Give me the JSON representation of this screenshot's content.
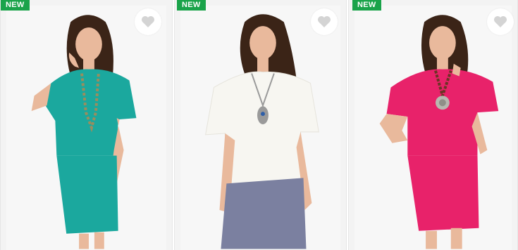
{
  "products": [
    {
      "badge": "NEW",
      "favorite_icon": "heart-icon",
      "outfit_color": "#1ba89e",
      "bottom_color": "#1ba89e",
      "necklace_color": "#9a8d5e",
      "pendant_shape": "beads"
    },
    {
      "badge": "NEW",
      "favorite_icon": "heart-icon",
      "outfit_color": "#f7f6f1",
      "bottom_color": "#7b80a0",
      "necklace_color": "#9a9a9a",
      "pendant_shape": "owl"
    },
    {
      "badge": "NEW",
      "favorite_icon": "heart-icon",
      "outfit_color": "#e8226a",
      "bottom_color": "#e8226a",
      "necklace_color": "#6b3424",
      "pendant_shape": "disc"
    }
  ],
  "colors": {
    "badge_bg": "#1aa34a",
    "badge_text": "#ffffff",
    "heart": "#d4d4d4",
    "skin": "#e9b99c",
    "hair": "#3b2417"
  }
}
